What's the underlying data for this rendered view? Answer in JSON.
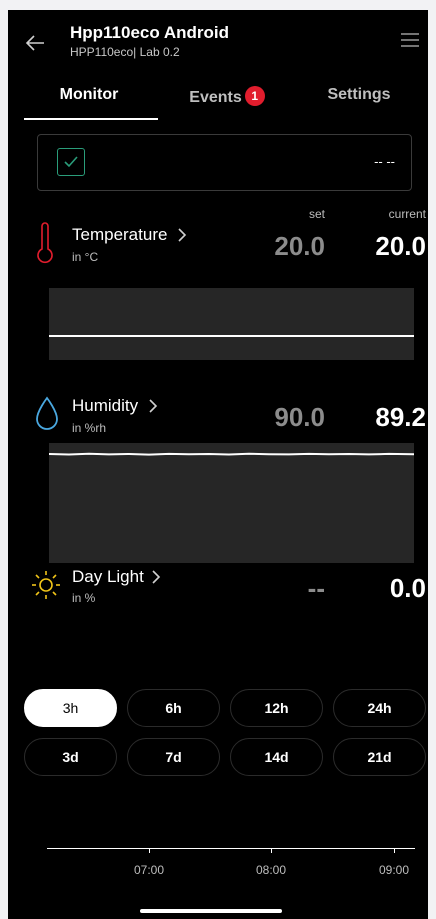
{
  "header": {
    "title": "Hpp110eco Android",
    "subtitle": "HPP110eco| Lab 0.2"
  },
  "tabs": {
    "monitor": "Monitor",
    "events": "Events",
    "events_badge": "1",
    "settings": "Settings",
    "active": "Monitor"
  },
  "status": {
    "value": "-- --",
    "check_color": "#2a9d7a"
  },
  "columns": {
    "set": "set",
    "current": "current"
  },
  "sensors": {
    "temperature": {
      "name": "Temperature",
      "unit": "in °C",
      "set": "20.0",
      "current": "20.0",
      "icon": "thermometer-icon",
      "color": "#e11d2d"
    },
    "humidity": {
      "name": "Humidity",
      "unit": "in %rh",
      "set": "90.0",
      "current": "89.2",
      "icon": "droplet-icon",
      "color": "#4aa8e0"
    },
    "daylight": {
      "name": "Day Light",
      "unit": "in %",
      "set": "--",
      "current": "0.0",
      "icon": "sun-icon",
      "color": "#f0c419"
    }
  },
  "time_ranges": [
    "3h",
    "6h",
    "12h",
    "24h",
    "3d",
    "7d",
    "14d",
    "21d"
  ],
  "selected_range": "3h",
  "time_axis": [
    "07:00",
    "08:00",
    "09:00"
  ]
}
